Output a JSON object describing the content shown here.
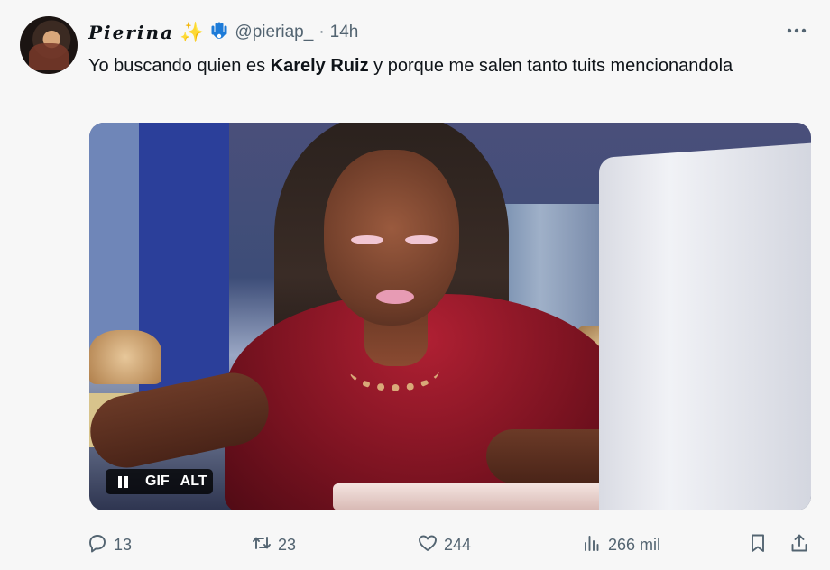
{
  "tweet": {
    "author": {
      "display_name": "Pierina",
      "emoji": [
        "sparkles",
        "hamsa"
      ],
      "handle": "@pieriap_",
      "separator": "·",
      "time": "14h"
    },
    "text": {
      "part1": "Yo buscando quien es ",
      "bold": "Karely Ruiz",
      "part2": " y porque me salen tanto tuits mencionandola"
    },
    "media": {
      "type": "gif",
      "badges": {
        "gif": "GIF",
        "alt": "ALT"
      },
      "state": "playing"
    },
    "actions": {
      "reply": "13",
      "retweet": "23",
      "like": "244",
      "views": "266 mil"
    }
  },
  "icons": {
    "more": "more-icon",
    "reply": "reply-icon",
    "retweet": "retweet-icon",
    "like": "heart-icon",
    "views": "views-icon",
    "bookmark": "bookmark-icon",
    "share": "share-icon"
  },
  "colors": {
    "background": "#f7f7f7",
    "text": "#0f1419",
    "secondary": "#536471",
    "sparkle": "#f2b531",
    "hamsa": "#1d7bd8"
  }
}
